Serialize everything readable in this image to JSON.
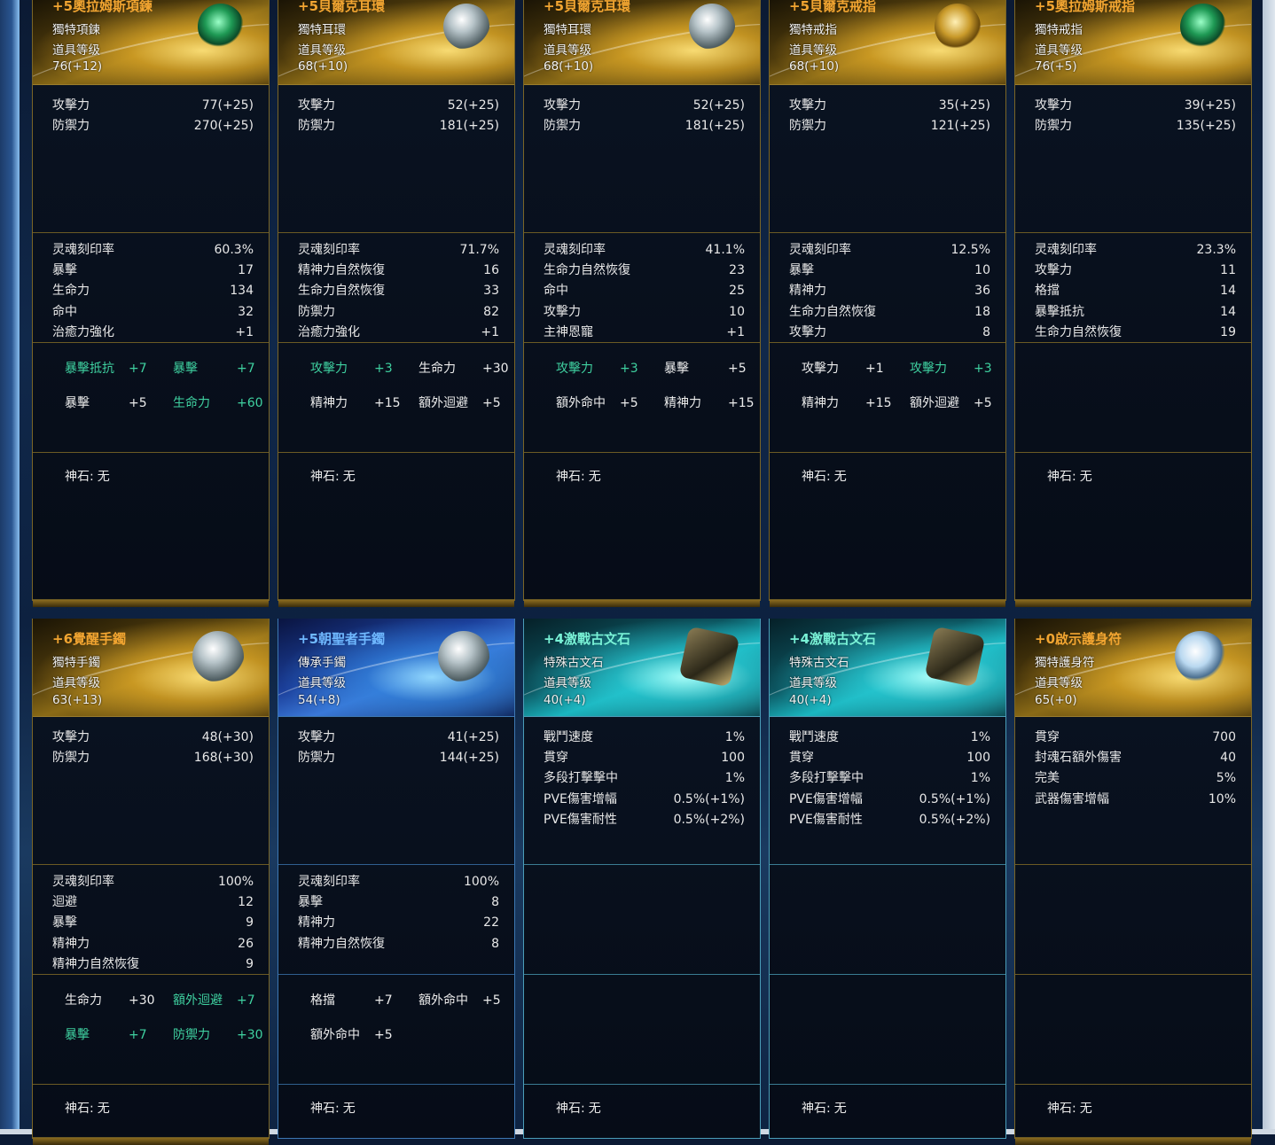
{
  "colors": {
    "gold": "#f2a531",
    "blue": "#6fb8ff",
    "teal": "#79f2d6",
    "green_stat": "#3fd1a0"
  },
  "row1": [
    {
      "title": "+5奧拉姆斯項鍊",
      "type": "獨特項鍊",
      "level_label": "道具等级",
      "level": "76(+12)",
      "icon": "necklace-icon",
      "base": [
        {
          "k": "攻擊力",
          "v": "77(+25)"
        },
        {
          "k": "防禦力",
          "v": "270(+25)"
        }
      ],
      "soul": [
        {
          "k": "灵魂刻印率",
          "v": "60.3%"
        },
        {
          "k": "暴擊",
          "v": "17"
        },
        {
          "k": "生命力",
          "v": "134"
        },
        {
          "k": "命中",
          "v": "32"
        },
        {
          "k": "治癒力強化",
          "v": "+1"
        }
      ],
      "ench": [
        [
          {
            "n": "暴擊抵抗",
            "v": "+7",
            "c": "green"
          },
          {
            "n": "暴擊",
            "v": "+7",
            "c": "green"
          }
        ],
        [
          {
            "n": "暴擊",
            "v": "+5",
            "c": "white"
          },
          {
            "n": "生命力",
            "v": "+60",
            "c": "green"
          }
        ]
      ],
      "god_label": "神石:",
      "god_value": "无"
    },
    {
      "title": "+5貝爾克耳環",
      "type": "獨特耳環",
      "level_label": "道具等级",
      "level": "68(+10)",
      "icon": "earring-icon",
      "base": [
        {
          "k": "攻擊力",
          "v": "52(+25)"
        },
        {
          "k": "防禦力",
          "v": "181(+25)"
        }
      ],
      "soul": [
        {
          "k": "灵魂刻印率",
          "v": "71.7%"
        },
        {
          "k": "精神力自然恢復",
          "v": "16"
        },
        {
          "k": "生命力自然恢復",
          "v": "33"
        },
        {
          "k": "防禦力",
          "v": "82"
        },
        {
          "k": "治癒力強化",
          "v": "+1"
        }
      ],
      "ench": [
        [
          {
            "n": "攻擊力",
            "v": "+3",
            "c": "green"
          },
          {
            "n": "生命力",
            "v": "+30",
            "c": "white"
          }
        ],
        [
          {
            "n": "精神力",
            "v": "+15",
            "c": "white"
          },
          {
            "n": "額外迴避",
            "v": "+5",
            "c": "white"
          }
        ]
      ],
      "god_label": "神石:",
      "god_value": "无"
    },
    {
      "title": "+5貝爾克耳環",
      "type": "獨特耳環",
      "level_label": "道具等级",
      "level": "68(+10)",
      "icon": "earring-icon",
      "base": [
        {
          "k": "攻擊力",
          "v": "52(+25)"
        },
        {
          "k": "防禦力",
          "v": "181(+25)"
        }
      ],
      "soul": [
        {
          "k": "灵魂刻印率",
          "v": "41.1%"
        },
        {
          "k": "生命力自然恢復",
          "v": "23"
        },
        {
          "k": "命中",
          "v": "25"
        },
        {
          "k": "攻擊力",
          "v": "10"
        },
        {
          "k": "主神恩寵",
          "v": "+1"
        }
      ],
      "ench": [
        [
          {
            "n": "攻擊力",
            "v": "+3",
            "c": "green"
          },
          {
            "n": "暴擊",
            "v": "+5",
            "c": "white"
          }
        ],
        [
          {
            "n": "額外命中",
            "v": "+5",
            "c": "white"
          },
          {
            "n": "精神力",
            "v": "+15",
            "c": "white"
          }
        ]
      ],
      "god_label": "神石:",
      "god_value": "无"
    },
    {
      "title": "+5貝爾克戒指",
      "type": "獨特戒指",
      "level_label": "道具等级",
      "level": "68(+10)",
      "icon": "ring-icon",
      "base": [
        {
          "k": "攻擊力",
          "v": "35(+25)"
        },
        {
          "k": "防禦力",
          "v": "121(+25)"
        }
      ],
      "soul": [
        {
          "k": "灵魂刻印率",
          "v": "12.5%"
        },
        {
          "k": "暴擊",
          "v": "10"
        },
        {
          "k": "精神力",
          "v": "36"
        },
        {
          "k": "生命力自然恢復",
          "v": "18"
        },
        {
          "k": "攻擊力",
          "v": "8"
        }
      ],
      "ench": [
        [
          {
            "n": "攻擊力",
            "v": "+1",
            "c": "white"
          },
          {
            "n": "攻擊力",
            "v": "+3",
            "c": "green"
          }
        ],
        [
          {
            "n": "精神力",
            "v": "+15",
            "c": "white"
          },
          {
            "n": "額外迴避",
            "v": "+5",
            "c": "white"
          }
        ]
      ],
      "god_label": "神石:",
      "god_value": "无"
    },
    {
      "title": "+5奧拉姆斯戒指",
      "type": "獨特戒指",
      "level_label": "道具等级",
      "level": "76(+5)",
      "icon": "ring-icon",
      "base": [
        {
          "k": "攻擊力",
          "v": "39(+25)"
        },
        {
          "k": "防禦力",
          "v": "135(+25)"
        }
      ],
      "soul": [
        {
          "k": "灵魂刻印率",
          "v": "23.3%"
        },
        {
          "k": "攻擊力",
          "v": "11"
        },
        {
          "k": "格擋",
          "v": "14"
        },
        {
          "k": "暴擊抵抗",
          "v": "14"
        },
        {
          "k": "生命力自然恢復",
          "v": "19"
        }
      ],
      "ench": [],
      "god_label": "神石:",
      "god_value": "无"
    }
  ],
  "row2": [
    {
      "title": "+6覺醒手鐲",
      "type": "獨特手鐲",
      "level_label": "道具等级",
      "level": "63(+13)",
      "icon": "bracelet-icon",
      "base": [
        {
          "k": "攻擊力",
          "v": "48(+30)"
        },
        {
          "k": "防禦力",
          "v": "168(+30)"
        }
      ],
      "soul": [
        {
          "k": "灵魂刻印率",
          "v": "100%"
        },
        {
          "k": "迴避",
          "v": "12"
        },
        {
          "k": "暴擊",
          "v": "9"
        },
        {
          "k": "精神力",
          "v": "26"
        },
        {
          "k": "精神力自然恢復",
          "v": "9"
        }
      ],
      "ench": [
        [
          {
            "n": "生命力",
            "v": "+30",
            "c": "white"
          },
          {
            "n": "額外迴避",
            "v": "+7",
            "c": "green"
          }
        ],
        [
          {
            "n": "暴擊",
            "v": "+7",
            "c": "green"
          },
          {
            "n": "防禦力",
            "v": "+30",
            "c": "green"
          }
        ]
      ],
      "god_label": "神石:",
      "god_value": "无"
    },
    {
      "title": "+5朝聖者手鐲",
      "type": "傳承手鐲",
      "level_label": "道具等级",
      "level": "54(+8)",
      "icon": "bracelet-icon",
      "base": [
        {
          "k": "攻擊力",
          "v": "41(+25)"
        },
        {
          "k": "防禦力",
          "v": "144(+25)"
        }
      ],
      "soul": [
        {
          "k": "灵魂刻印率",
          "v": "100%"
        },
        {
          "k": "暴擊",
          "v": "8"
        },
        {
          "k": "精神力",
          "v": "22"
        },
        {
          "k": "精神力自然恢復",
          "v": "8"
        }
      ],
      "ench": [
        [
          {
            "n": "格擋",
            "v": "+7",
            "c": "white"
          },
          {
            "n": "額外命中",
            "v": "+5",
            "c": "white"
          }
        ],
        [
          {
            "n": "額外命中",
            "v": "+5",
            "c": "white"
          }
        ]
      ],
      "god_label": "神石:",
      "god_value": "无"
    },
    {
      "title": "+4激戰古文石",
      "type": "特殊古文石",
      "level_label": "道具等级",
      "level": "40(+4)",
      "icon": "rune-icon",
      "base": [
        {
          "k": "戰鬥速度",
          "v": "1%"
        },
        {
          "k": "貫穿",
          "v": "100"
        },
        {
          "k": "多段打擊擊中",
          "v": "1%"
        },
        {
          "k": "PVE傷害增幅",
          "v": "0.5%(+1%)"
        },
        {
          "k": "PVE傷害耐性",
          "v": "0.5%(+2%)"
        }
      ],
      "soul": [],
      "ench": [],
      "god_label": "神石:",
      "god_value": "无"
    },
    {
      "title": "+4激戰古文石",
      "type": "特殊古文石",
      "level_label": "道具等级",
      "level": "40(+4)",
      "icon": "rune-icon",
      "base": [
        {
          "k": "戰鬥速度",
          "v": "1%"
        },
        {
          "k": "貫穿",
          "v": "100"
        },
        {
          "k": "多段打擊擊中",
          "v": "1%"
        },
        {
          "k": "PVE傷害增幅",
          "v": "0.5%(+1%)"
        },
        {
          "k": "PVE傷害耐性",
          "v": "0.5%(+2%)"
        }
      ],
      "soul": [],
      "ench": [],
      "god_label": "神石:",
      "god_value": "无"
    },
    {
      "title": "+0啟示護身符",
      "type": "獨特護身符",
      "level_label": "道具等级",
      "level": "65(+0)",
      "icon": "amulet-icon",
      "base": [
        {
          "k": "貫穿",
          "v": "700"
        },
        {
          "k": "封魂石額外傷害",
          "v": "40"
        },
        {
          "k": "完美",
          "v": "5%"
        },
        {
          "k": "武器傷害增幅",
          "v": "10%"
        }
      ],
      "soul": [],
      "ench": [],
      "god_label": "神石:",
      "god_value": "无"
    }
  ]
}
